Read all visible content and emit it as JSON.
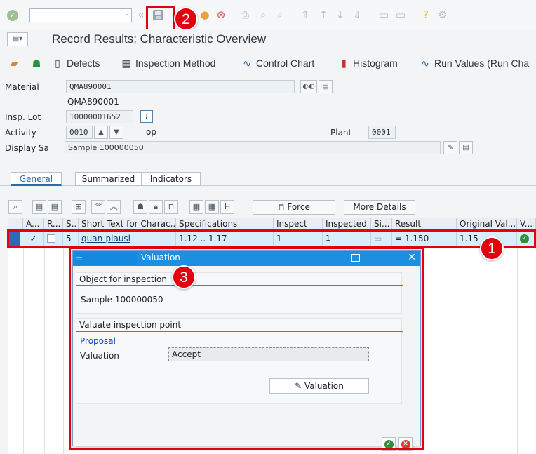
{
  "toolbar": {
    "command_value": "",
    "callouts": {
      "save": "2",
      "row": "1",
      "dialog": "3"
    }
  },
  "title": "Record Results: Characteristic Overview",
  "app_toolbar": {
    "defects": "Defects",
    "inspection_method": "Inspection Method",
    "control_chart": "Control Chart",
    "histogram": "Histogram",
    "run_values": "Run Values (Run Cha"
  },
  "form": {
    "material_label": "Material",
    "material_value": "QMA890001",
    "material_text": "QMA890001",
    "insp_lot_label": "Insp. Lot",
    "insp_lot_value": "10000001652",
    "activity_label": "Activity",
    "activity_value": "0010",
    "activity_text": "op",
    "plant_label": "Plant",
    "plant_value": "0001",
    "display_sample_label": "Display Sa",
    "display_sample_value": "Sample 100000050"
  },
  "tabs": [
    "General",
    "Summarized",
    "Indicators"
  ],
  "table_toolbar": {
    "force": "Force",
    "more_details": "More Details"
  },
  "grid": {
    "headers": [
      "A...",
      "R...",
      "S..",
      "Short Text for Charac...",
      "Specifications",
      "Inspect",
      "Inspected",
      "Si...",
      "Result",
      "Original Val...",
      "V..."
    ],
    "row": {
      "seq": "5",
      "short_text": "quan-plausi",
      "specifications": "1.12 .. 1.17",
      "inspect": "1",
      "inspected": "1",
      "result_op": "=",
      "result": "1.150",
      "original_value": "1.15"
    }
  },
  "dialog": {
    "title": "Valuation",
    "object_header": "Object for inspection",
    "object_value": "Sample 100000050",
    "valuate_header": "Valuate inspection point",
    "proposal": "Proposal",
    "valuation_label": "Valuation",
    "valuation_value": "Accept",
    "valuation_button": "Valuation"
  }
}
